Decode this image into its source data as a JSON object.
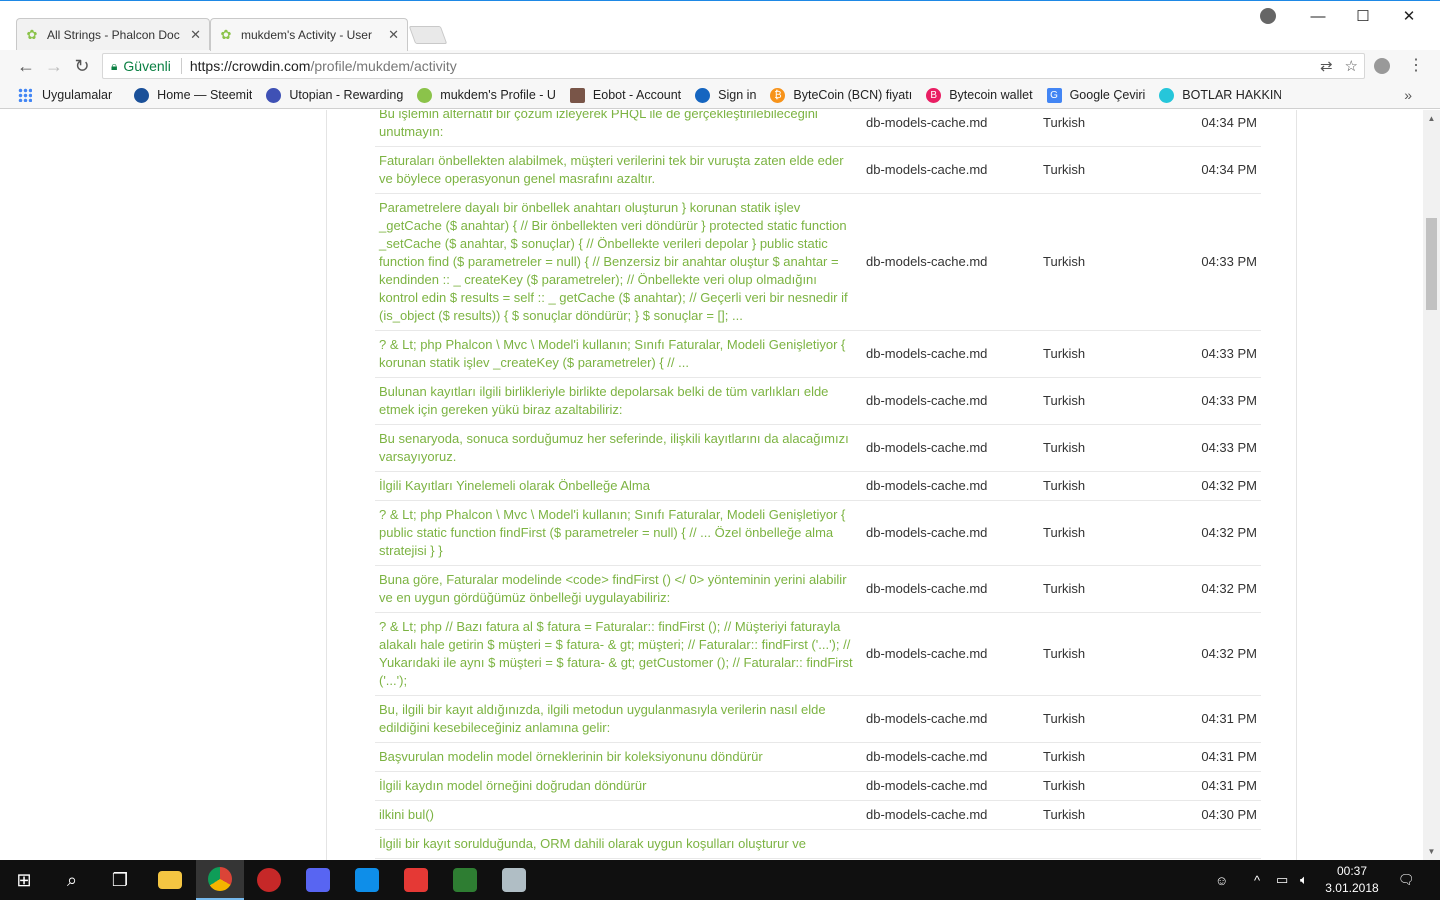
{
  "browser": {
    "tabs": [
      {
        "title": "All Strings - Phalcon Doc",
        "active": false
      },
      {
        "title": "mukdem's Activity - User",
        "active": true
      }
    ],
    "security_label": "Güvenli",
    "url_host": "https://crowdin.com",
    "url_path": "/profile/mukdem/activity"
  },
  "bookmarks": [
    {
      "label": "Uygulamalar",
      "icon": "apps-grid-icon",
      "color": "#4285f4"
    },
    {
      "label": "Home — Steemit",
      "icon": "steemit-icon",
      "color": "#1a5099"
    },
    {
      "label": "Utopian - Rewarding",
      "icon": "utopian-icon",
      "color": "#3f51b5"
    },
    {
      "label": "mukdem's Profile - U",
      "icon": "crowdin-icon",
      "color": "#8bc34a"
    },
    {
      "label": "Eobot - Account",
      "icon": "eobot-icon",
      "color": "#795548"
    },
    {
      "label": "Sign in",
      "icon": "sign-in-icon",
      "color": "#1565c0"
    },
    {
      "label": "ByteCoin (BCN) fiyatı",
      "icon": "bytecoin-icon",
      "color": "#f7931a"
    },
    {
      "label": "Bytecoin wallet",
      "icon": "bytecoin-wallet-icon",
      "color": "#e91e63"
    },
    {
      "label": "Google Çeviri",
      "icon": "google-translate-icon",
      "color": "#4285f4"
    },
    {
      "label": "BOTLAR HAKKINDA B",
      "icon": "bots-icon",
      "color": "#26c6da"
    }
  ],
  "activity": {
    "rows": [
      {
        "text": "Bu işlemin alternatif bir çözüm izleyerek PHQL ile de gerçekleştirilebileceğini unutmayın:",
        "file": "db-models-cache.md",
        "language": "Turkish",
        "time": "04:34 PM"
      },
      {
        "text": "Faturaları önbellekten alabilmek, müşteri verilerini tek bir vuruşta zaten elde eder ve böylece operasyonun genel masrafını azaltır.",
        "file": "db-models-cache.md",
        "language": "Turkish",
        "time": "04:34 PM"
      },
      {
        "text": "Parametrelere dayalı bir önbellek anahtarı oluşturun     }      korunan statik işlev _getCache ($ anahtar)     {         // Bir önbellekten veri döndürür     }     protected static function _setCache ($ anahtar, $ sonuçlar)     {         // Önbellekte verileri depolar     }     public static function find ($ parametreler = null)     {         // Benzersiz bir anahtar oluştur         $ anahtar = kendinden :: _ createKey ($ parametreler);         // Önbellekte veri olup olmadığını kontrol edin         $ results = self :: _ getCache ($ anahtar);         // Geçerli veri bir nesnedir         if (is_object ($ results)) {             $ sonuçlar döndürür;         }         $ sonuçlar = [];     ...",
        "file": "db-models-cache.md",
        "language": "Turkish",
        "time": "04:33 PM"
      },
      {
        "text": "? & Lt; php Phalcon \\ Mvc \\ Model'i kullanın; Sınıfı Faturalar, Modeli Genişletiyor {     korunan statik işlev _createKey ($ parametreler)     {         // ...",
        "file": "db-models-cache.md",
        "language": "Turkish",
        "time": "04:33 PM"
      },
      {
        "text": "Bulunan kayıtları ilgili birlikleriyle birlikte depolarsak belki de tüm varlıkları elde etmek için gereken yükü biraz azaltabiliriz:",
        "file": "db-models-cache.md",
        "language": "Turkish",
        "time": "04:33 PM"
      },
      {
        "text": "Bu senaryoda, sonuca sorduğumuz her seferinde, ilişkili kayıtlarını da alacağımızı varsayıyoruz.",
        "file": "db-models-cache.md",
        "language": "Turkish",
        "time": "04:33 PM"
      },
      {
        "text": "İlgili Kayıtları Yinelemeli olarak Önbelleğe Alma",
        "file": "db-models-cache.md",
        "language": "Turkish",
        "time": "04:32 PM"
      },
      {
        "text": "? & Lt; php Phalcon \\ Mvc \\ Model'i kullanın; Sınıfı Faturalar, Modeli Genişletiyor {     public static function findFirst ($ parametreler = null)     {         // ... Özel önbelleğe alma stratejisi     } }",
        "file": "db-models-cache.md",
        "language": "Turkish",
        "time": "04:32 PM"
      },
      {
        "text": "Buna göre, Faturalar modelinde <code> findFirst () </ 0> yönteminin yerini alabilir ve en uygun gördüğümüz önbelleği uygulayabiliriz:",
        "file": "db-models-cache.md",
        "language": "Turkish",
        "time": "04:32 PM"
      },
      {
        "text": "? & Lt; php // Bazı fatura al $ fatura = Faturalar:: findFirst (); // Müşteriyi faturayla alakalı hale getirin $ müşteri = $ fatura- & gt; müşteri; // Faturalar:: findFirst ('...'); // Yukarıdaki ile aynı $ müşteri = $ fatura- & gt; getCustomer (); // Faturalar:: findFirst ('...');",
        "file": "db-models-cache.md",
        "language": "Turkish",
        "time": "04:32 PM"
      },
      {
        "text": "Bu, ilgili bir kayıt aldığınızda, ilgili metodun uygulanmasıyla verilerin nasıl elde edildiğini kesebileceğiniz anlamına gelir:",
        "file": "db-models-cache.md",
        "language": "Turkish",
        "time": "04:31 PM"
      },
      {
        "text": "Başvurulan modelin model örneklerinin bir koleksiyonunu döndürür",
        "file": "db-models-cache.md",
        "language": "Turkish",
        "time": "04:31 PM"
      },
      {
        "text": "İlgili kaydın model örneğini doğrudan döndürür",
        "file": "db-models-cache.md",
        "language": "Turkish",
        "time": "04:31 PM"
      },
      {
        "text": "ilkini bul()",
        "file": "db-models-cache.md",
        "language": "Turkish",
        "time": "04:30 PM"
      },
      {
        "text": "İlgili bir kayıt sorulduğunda, ORM dahili olarak uygun koşulları oluşturur ve",
        "file": "",
        "language": "",
        "time": ""
      }
    ]
  },
  "taskbar": {
    "time": "00:37",
    "date": "3.01.2018"
  },
  "colors": {
    "link_green": "#7cb342",
    "taskbar_bg": "#101010",
    "secure_green": "#0b8043"
  }
}
